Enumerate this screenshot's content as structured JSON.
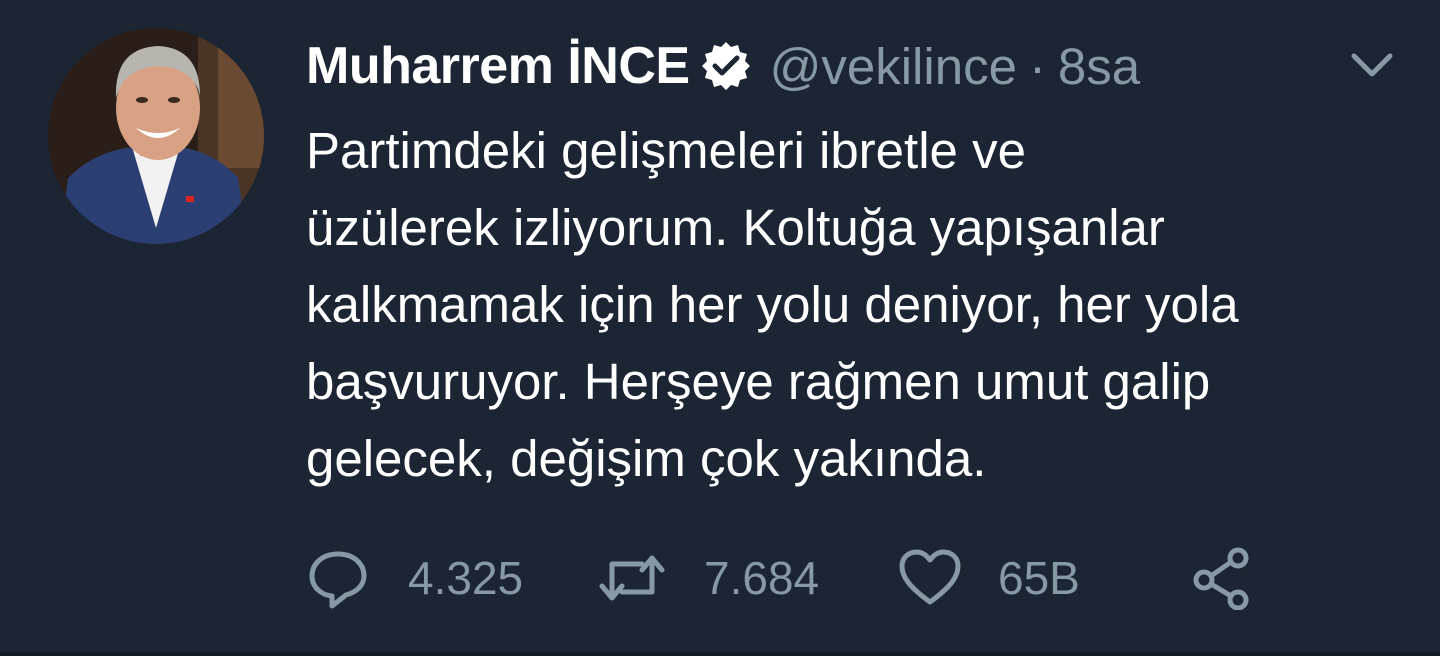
{
  "colors": {
    "background": "#1b2533",
    "primary_text": "#ffffff",
    "secondary_text": "#8899a6"
  },
  "tweet": {
    "author": {
      "display_name": "Muharrem İNCE",
      "verified_icon": "verified-badge-icon",
      "handle": "@vekilince",
      "separator": "·",
      "time": "8sa"
    },
    "text": "Partimdeki gelişmeleri ibretle ve\nüzülerek izliyorum. Koltuğa yapışanlar\nkalkmamak için her yolu deniyor, her yola\nbaşvuruyor. Herşeye rağmen umut galip\ngelecek, değişim çok yakında.",
    "actions": {
      "reply": {
        "icon": "reply-icon",
        "count": "4.325"
      },
      "retweet": {
        "icon": "retweet-icon",
        "count": "7.684"
      },
      "like": {
        "icon": "heart-icon",
        "count": "65B"
      },
      "share": {
        "icon": "share-icon"
      }
    },
    "menu_icon": "chevron-down-icon"
  }
}
